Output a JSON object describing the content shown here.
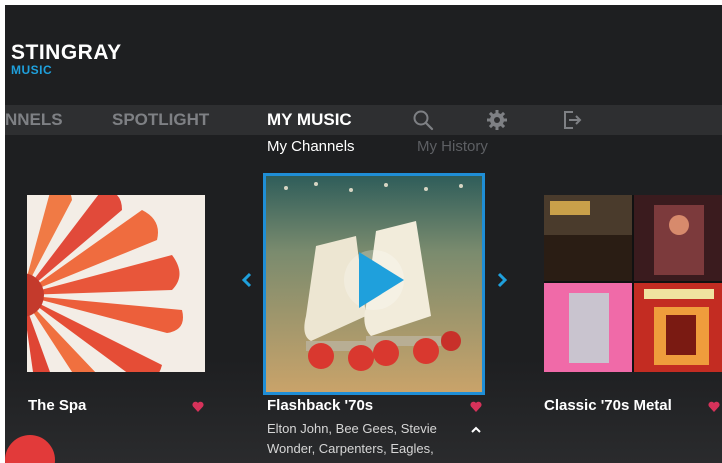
{
  "app": {
    "brand": "STINGRAY",
    "brand_sub": "MUSIC"
  },
  "nav": {
    "items": [
      {
        "label": "NNELS",
        "active": false
      },
      {
        "label": "SPOTLIGHT",
        "active": false
      },
      {
        "label": "MY MUSIC",
        "active": true
      }
    ],
    "icons": [
      "search-icon",
      "gear-icon",
      "logout-icon"
    ]
  },
  "subtabs": [
    {
      "label": "My Channels",
      "active": true
    },
    {
      "label": "My History",
      "active": false
    }
  ],
  "channels": [
    {
      "title": "The Spa",
      "favorite": true
    },
    {
      "title": "Flashback '70s",
      "favorite": true,
      "artists": "Elton John, Bee Gees, Stevie Wonder, Carpenters, Eagles,"
    },
    {
      "title": "Classic '70s Metal",
      "favorite": true
    }
  ],
  "colors": {
    "accent": "#1fa0dc",
    "heart": "#d6325a",
    "background": "#1e1f21",
    "navbar": "#2e2f31"
  }
}
